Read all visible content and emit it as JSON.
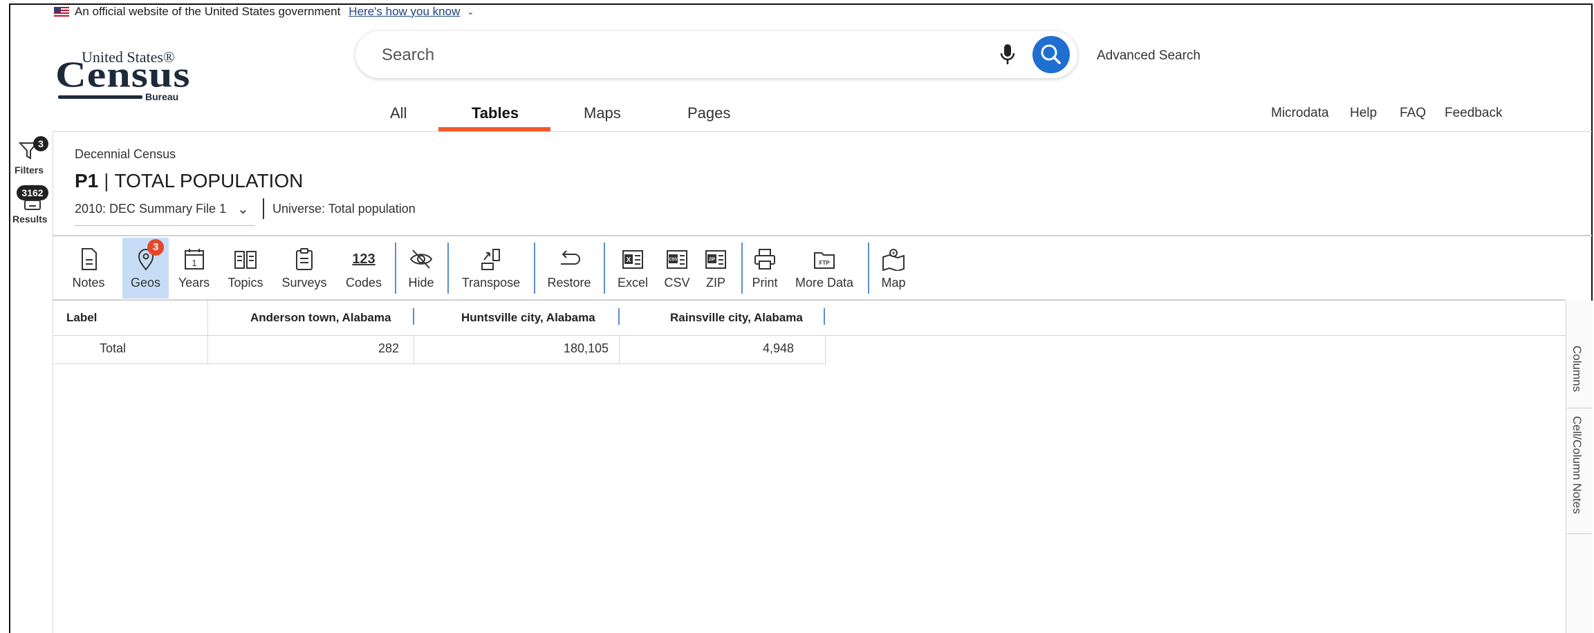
{
  "gov_banner": {
    "text": "An official website of the United States government",
    "link": "Here's how you know"
  },
  "logo": {
    "top": "United States®",
    "main": "Census",
    "sub": "Bureau"
  },
  "search": {
    "placeholder": "Search",
    "advanced_label": "Advanced Search"
  },
  "tabs": [
    {
      "label": "All",
      "active": false
    },
    {
      "label": "Tables",
      "active": true
    },
    {
      "label": "Maps",
      "active": false
    },
    {
      "label": "Pages",
      "active": false
    }
  ],
  "util_links": [
    "Microdata",
    "Help",
    "FAQ",
    "Feedback"
  ],
  "rail": {
    "filters_label": "Filters",
    "filters_count": "3",
    "results_count": "3162",
    "results_label": "Results"
  },
  "table_header": {
    "survey": "Decennial Census",
    "table_id": "P1",
    "title": "TOTAL POPULATION",
    "vintage": "2010: DEC Summary File 1",
    "universe": "Universe: Total population"
  },
  "toolbar": {
    "notes": "Notes",
    "geos": "Geos",
    "geos_badge": "3",
    "years": "Years",
    "topics": "Topics",
    "surveys": "Surveys",
    "codes": "Codes",
    "codes_glyph": "123",
    "hide": "Hide",
    "transpose": "Transpose",
    "restore": "Restore",
    "excel": "Excel",
    "csv": "CSV",
    "zip": "ZIP",
    "print": "Print",
    "more_data": "More Data",
    "map": "Map"
  },
  "table": {
    "columns": [
      "Label",
      "Anderson town, Alabama",
      "Huntsville city, Alabama",
      "Rainsville city, Alabama"
    ],
    "rows": [
      {
        "label": "Total",
        "values": [
          "282",
          "180,105",
          "4,948"
        ]
      }
    ]
  },
  "side_tabs": [
    "Columns",
    "Cell/Column Notes"
  ],
  "colors": {
    "accent_orange": "#f05a28",
    "search_blue": "#1f6fd1",
    "active_tool_bg": "#c7ddf5",
    "divider_blue": "#5b8ed1"
  }
}
